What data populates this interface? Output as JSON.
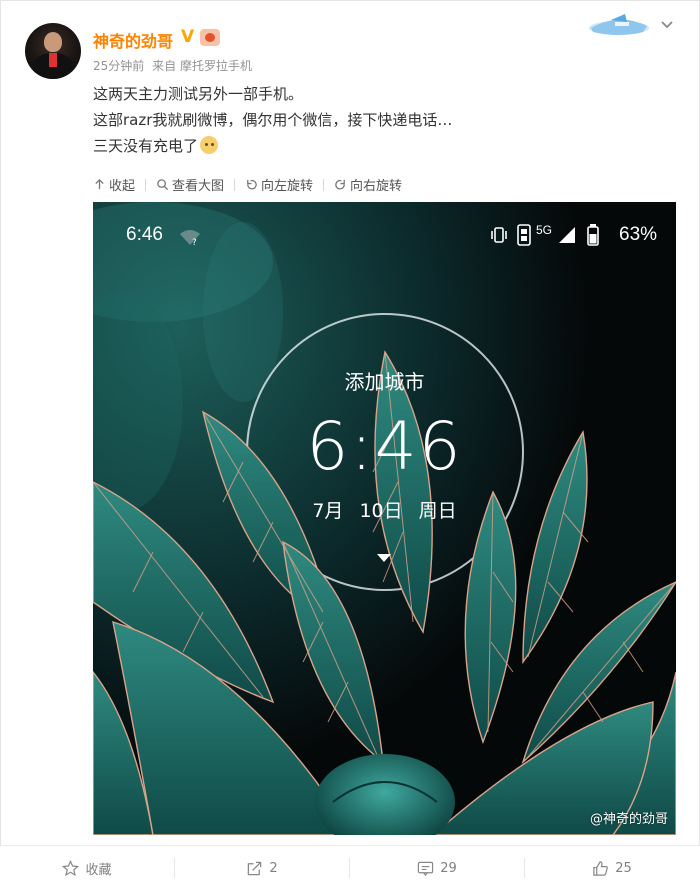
{
  "post": {
    "username": "神奇的劲哥",
    "verified_mark": "V",
    "time": "25分钟前",
    "source_prefix": "来自",
    "source_device": "摩托罗拉手机",
    "lines": [
      "这两天主力测试另外一部手机。",
      "这部razr我就刷微博，偶尔用个微信，接下快递电话…",
      "三天没有充电了"
    ]
  },
  "image_toolbar": {
    "collapse": "收起",
    "view_large": "查看大图",
    "rotate_left": "向左旋转",
    "rotate_right": "向右旋转"
  },
  "phone_screen": {
    "status_time": "6:46",
    "network": "5G",
    "battery": "63%",
    "city": "添加城市",
    "clock": "6:46",
    "date": "7月 10日 周日",
    "watermark": "@神奇的劲哥"
  },
  "actions": {
    "favorite": "收藏",
    "repost_count": "2",
    "comment_count": "29",
    "like_count": "25"
  },
  "colors": {
    "username": "#ff8200",
    "verified": "#ffa500",
    "meta": "#939393",
    "leaf": "#1f6f6a",
    "leaf_vein": "#d9a38a"
  }
}
